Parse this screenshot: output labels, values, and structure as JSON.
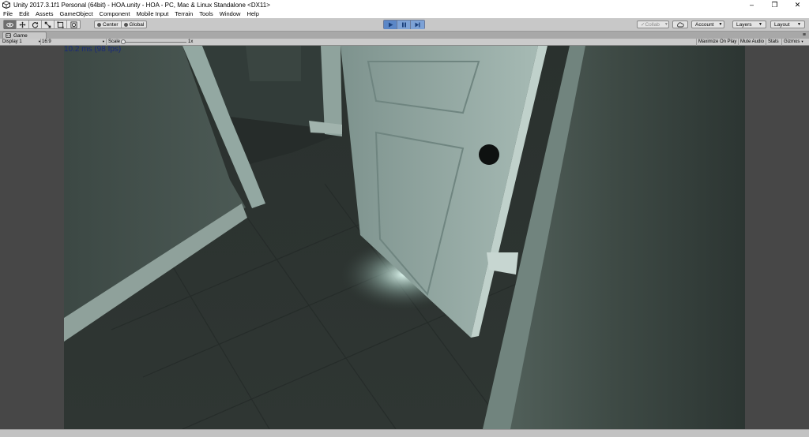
{
  "window": {
    "title": "Unity 2017.3.1f1 Personal (64bit) - HOA.unity - HOA - PC, Mac & Linux Standalone <DX11>",
    "icon": "unity-logo-icon",
    "controls": {
      "minimize": "–",
      "restore": "❐",
      "close": "✕"
    }
  },
  "menu": [
    "File",
    "Edit",
    "Assets",
    "GameObject",
    "Component",
    "Mobile Input",
    "Terrain",
    "Tools",
    "Window",
    "Help"
  ],
  "toolbar": {
    "tools": [
      "view-tool-icon",
      "move-tool-icon",
      "rotate-tool-icon",
      "scale-tool-icon",
      "rect-tool-icon",
      "transform-tool-icon"
    ],
    "pivot_label": "Center",
    "space_label": "Global",
    "play_state": "playing",
    "collab_label": "Collab",
    "account_label": "Account",
    "layers_label": "Layers",
    "layout_label": "Layout"
  },
  "game_tab": {
    "label": "Game",
    "icon": "game-view-icon",
    "display_label": "Display 1",
    "aspect_label": "16:9",
    "scale_label": "Scale",
    "scale_value": "1x",
    "scale_fraction": 0,
    "maximize_label": "Maximize On Play",
    "mute_label": "Mute Audio",
    "stats_label": "Stats",
    "gizmos_label": "Gizmos"
  },
  "game_view": {
    "fps_text": "10.2 ms (98 fps)",
    "fps_color": "#1b2a7a",
    "scene_description_colors": {
      "wall": "#3f4b46",
      "floor": "#2d3531",
      "door": "#8fa5a0",
      "light": "#d8efe8"
    }
  },
  "colors": {
    "play_accent": "#5b87c7",
    "editor_bg": "#c8c8c8"
  }
}
